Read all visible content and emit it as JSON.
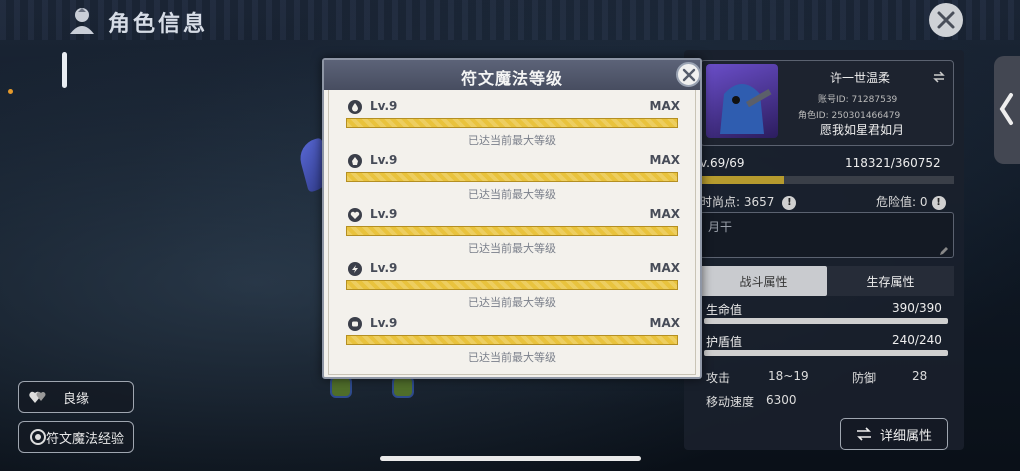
{
  "header": {
    "title": "角色信息"
  },
  "left_buttons": {
    "bond_label": "良缘",
    "rune_exp_label": "符文魔法经验"
  },
  "modal": {
    "title": "符文魔法等级",
    "runes": [
      {
        "icon": "drop-icon",
        "level": "Lv.9",
        "max": "MAX",
        "status": "已达当前最大等级"
      },
      {
        "icon": "flame-icon",
        "level": "Lv.9",
        "max": "MAX",
        "status": "已达当前最大等级"
      },
      {
        "icon": "heart-shield-icon",
        "level": "Lv.9",
        "max": "MAX",
        "status": "已达当前最大等级"
      },
      {
        "icon": "lightning-icon",
        "level": "Lv.9",
        "max": "MAX",
        "status": "已达当前最大等级"
      },
      {
        "icon": "face-icon",
        "level": "Lv.9",
        "max": "MAX",
        "status": "已达当前最大等级"
      }
    ],
    "progress_fraction": 1.0
  },
  "profile": {
    "name": "许一世温柔",
    "account_id": "账号ID: 71287539",
    "role_id": "角色ID: 250301466479",
    "motto": "愿我如星君如月",
    "level": "v.69/69",
    "exp": "118321/360752",
    "exp_fraction": 0.33,
    "fashion_points": "时尚点: 3657",
    "danger": "危险值: 0",
    "note": "月干"
  },
  "tabs": {
    "combat": "战斗属性",
    "survival": "生存属性"
  },
  "stats": {
    "hp_label": "生命值",
    "hp_value": "390/390",
    "shield_label": "护盾值",
    "shield_value": "240/240",
    "attack_label": "攻击",
    "attack_value": "18~19",
    "defense_label": "防御",
    "defense_value": "28",
    "speed_label": "移动速度",
    "speed_value": "6300"
  },
  "detail_button": "详细属性",
  "colors": {
    "rune_bar": "#e9c33d",
    "modal_header": "#4f566a",
    "exp_fill": "#b69b2e"
  }
}
